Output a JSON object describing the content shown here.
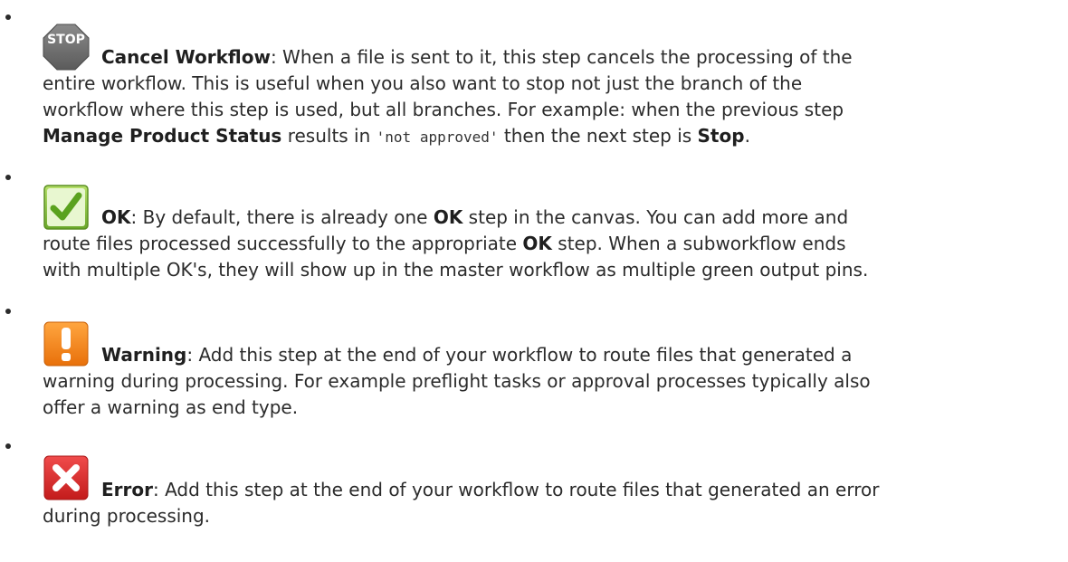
{
  "items": [
    {
      "icon": "stop-icon",
      "icon_text": "STOP",
      "term": "Cancel Workflow",
      "line1": ": When a file is sent to it, this step cancels the processing of the",
      "line2": "entire workflow. This is useful when you also want to stop not just the branch of the",
      "line3": "workflow where this step is used, but all branches. For example: when the previous step",
      "line4_bold1": "Manage Product Status",
      "line4_mid": " results in ",
      "line4_code": "'not approved'",
      "line4_mid2": " then the next step is ",
      "line4_bold2": "Stop",
      "line4_end": "."
    },
    {
      "icon": "ok-check-icon",
      "term": "OK",
      "line1_a": ": By default, there is already one ",
      "line1_bold": "OK",
      "line1_b": " step in the canvas. You can add more and",
      "line2_a": "route files processed successfully to the appropriate ",
      "line2_bold": "OK",
      "line2_b": " step. When a subworkflow ends",
      "line3": "with multiple OK's, they will show up in the master workflow as multiple green output pins."
    },
    {
      "icon": "warning-icon",
      "term": "Warning",
      "line1": ": Add this step at the end of your workflow to route files that generated a",
      "line2": "warning during processing. For example preflight tasks or approval processes typically also",
      "line3": "offer a warning as end type."
    },
    {
      "icon": "error-icon",
      "term": "Error",
      "line1": ": Add this step at the end of your workflow to route files that generated an error",
      "line2": "during processing."
    }
  ]
}
